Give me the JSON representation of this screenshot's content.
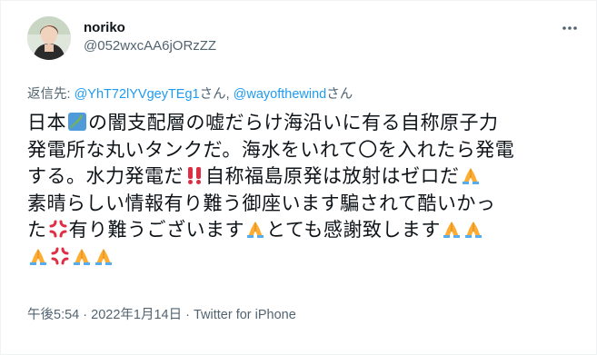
{
  "user": {
    "display_name": "noriko",
    "handle": "@052wxcAA6jORzZZ"
  },
  "reply": {
    "prefix": "返信先: ",
    "mention1": "@YhT72lYVgeyTEg1",
    "suffix1": "さん, ",
    "mention2": "@wayofthewind",
    "suffix2": "さん"
  },
  "text": {
    "l1a": "日本",
    "l1b": "の闇支配層の嘘だらけ海沿いに有る自称原子力",
    "l2": "発電所な丸いタンクだ。海水をいれて〇を入れたら発電",
    "l3a": "する。水力発電だ",
    "l3b": "自称福島原発は放射はゼロだ",
    "l4": "素晴らしい情報有り難う御座います騙されて酷いかっ",
    "l5a": "た",
    "l5b": "有り難うございます",
    "l5c": "とても感謝致します"
  },
  "emoji": {
    "japan_map": "japan-map-emoji",
    "double_exclamation": "double-exclamation-emoji",
    "folded_hands": "folded-hands-emoji",
    "anger_symbol": "anger-symbol-emoji"
  },
  "meta": {
    "time": "午後5:54",
    "sep1": " · ",
    "date": "2022年1月14日",
    "sep2": " · ",
    "source": "Twitter for iPhone"
  },
  "colors": {
    "link": "#1d9bf0",
    "secondary_text": "#536471",
    "primary_text": "#0f1419"
  }
}
